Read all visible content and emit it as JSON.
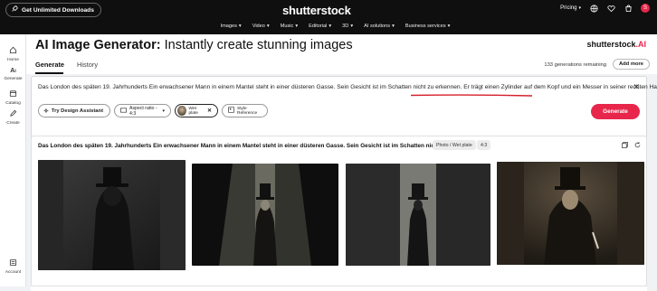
{
  "topbar": {
    "download_label": "Get Unlimited Downloads",
    "logo": "shutterstock",
    "pricing_label": "Pricing",
    "avatar_initial": "S",
    "nav": [
      "Images",
      "Video",
      "Music",
      "Editorial",
      "3D",
      "AI solutions",
      "Business services"
    ]
  },
  "sidebar": {
    "items": [
      {
        "label": "Home",
        "icon": "home-icon"
      },
      {
        "label": "Generate",
        "icon": "ai-generate-icon"
      },
      {
        "label": "Catalog",
        "icon": "catalog-icon"
      },
      {
        "label": "Create",
        "icon": "create-icon"
      }
    ],
    "account_label": "Account"
  },
  "header": {
    "title_bold": "AI Image Generator:",
    "title_rest": "Instantly create stunning images",
    "brand": "shutterstock",
    "brand_suffix": ".AI",
    "tabs": [
      "Generate",
      "History"
    ],
    "generations_remaining": "133 generations remaining",
    "add_more_label": "Add more"
  },
  "prompt": {
    "text": "Das London des späten 19. Jahrhunderts Ein erwachsener Mann in einem Mantel steht in einer düsteren Gasse. Sein Gesicht ist im Schatten nicht zu erkennen. Er trägt einen Zylinder auf dem Kopf und ein Messer in seiner rechten Hand.",
    "design_assistant_label": "Try Design Assistant",
    "aspect_ratio_label": "Aspect ratio - 4:3",
    "style_chip_label": "Wet plate",
    "style_reference_label": "Style Reference",
    "generate_label": "Generate"
  },
  "results": {
    "title": "Das London des späten 19. Jahrhunderts Ein erwachsener Mann in einem Mantel steht in einer düsteren Gasse. Sein Gesicht ist im Schatten nicht...",
    "style_chip": "Photo / Wet plate",
    "ratio_chip": "4:3"
  },
  "colors": {
    "accent": "#e8264b",
    "topbar": "#0f0f0f",
    "underline": "#d61f2c"
  }
}
